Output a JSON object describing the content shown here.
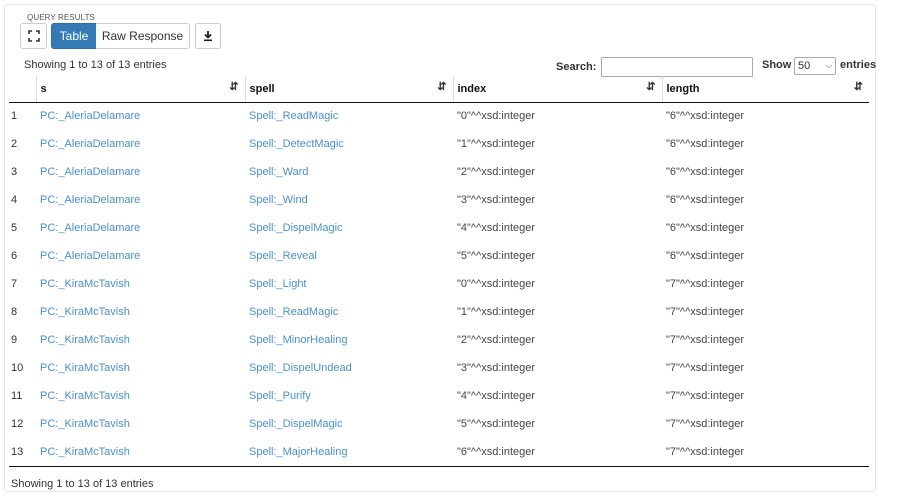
{
  "panel": {
    "title": "QUERY RESULTS"
  },
  "toolbar": {
    "expand_icon": "expand-icon",
    "table_label": "Table",
    "raw_label": "Raw Response",
    "download_icon": "download-icon",
    "active_color": "#337ab7"
  },
  "info": {
    "top": "Showing 1 to 13 of 13 entries",
    "bottom": "Showing 1 to 13 of 13 entries"
  },
  "search": {
    "label": "Search:",
    "value": ""
  },
  "show": {
    "label": "Show",
    "value": "50",
    "suffix": "entries"
  },
  "table": {
    "columns": [
      "",
      "s",
      "spell",
      "index",
      "length"
    ],
    "rows": [
      {
        "n": "1",
        "s": "PC:_AleriaDelamare",
        "spell": "Spell:_ReadMagic",
        "index": "\"0\"^^xsd:integer",
        "length": "\"6\"^^xsd:integer"
      },
      {
        "n": "2",
        "s": "PC:_AleriaDelamare",
        "spell": "Spell:_DetectMagic",
        "index": "\"1\"^^xsd:integer",
        "length": "\"6\"^^xsd:integer"
      },
      {
        "n": "3",
        "s": "PC:_AleriaDelamare",
        "spell": "Spell:_Ward",
        "index": "\"2\"^^xsd:integer",
        "length": "\"6\"^^xsd:integer"
      },
      {
        "n": "4",
        "s": "PC:_AleriaDelamare",
        "spell": "Spell:_Wind",
        "index": "\"3\"^^xsd:integer",
        "length": "\"6\"^^xsd:integer"
      },
      {
        "n": "5",
        "s": "PC:_AleriaDelamare",
        "spell": "Spell:_DispelMagic",
        "index": "\"4\"^^xsd:integer",
        "length": "\"6\"^^xsd:integer"
      },
      {
        "n": "6",
        "s": "PC:_AleriaDelamare",
        "spell": "Spell:_Reveal",
        "index": "\"5\"^^xsd:integer",
        "length": "\"6\"^^xsd:integer"
      },
      {
        "n": "7",
        "s": "PC:_KiraMcTavish",
        "spell": "Spell:_Light",
        "index": "\"0\"^^xsd:integer",
        "length": "\"7\"^^xsd:integer"
      },
      {
        "n": "8",
        "s": "PC:_KiraMcTavish",
        "spell": "Spell:_ReadMagic",
        "index": "\"1\"^^xsd:integer",
        "length": "\"7\"^^xsd:integer"
      },
      {
        "n": "9",
        "s": "PC:_KiraMcTavish",
        "spell": "Spell:_MinorHealing",
        "index": "\"2\"^^xsd:integer",
        "length": "\"7\"^^xsd:integer"
      },
      {
        "n": "10",
        "s": "PC:_KiraMcTavish",
        "spell": "Spell:_DispelUndead",
        "index": "\"3\"^^xsd:integer",
        "length": "\"7\"^^xsd:integer"
      },
      {
        "n": "11",
        "s": "PC:_KiraMcTavish",
        "spell": "Spell:_Purify",
        "index": "\"4\"^^xsd:integer",
        "length": "\"7\"^^xsd:integer"
      },
      {
        "n": "12",
        "s": "PC:_KiraMcTavish",
        "spell": "Spell:_DispelMagic",
        "index": "\"5\"^^xsd:integer",
        "length": "\"7\"^^xsd:integer"
      },
      {
        "n": "13",
        "s": "PC:_KiraMcTavish",
        "spell": "Spell:_MajorHealing",
        "index": "\"6\"^^xsd:integer",
        "length": "\"7\"^^xsd:integer"
      }
    ]
  },
  "colors": {
    "link": "#4a8fd1"
  }
}
